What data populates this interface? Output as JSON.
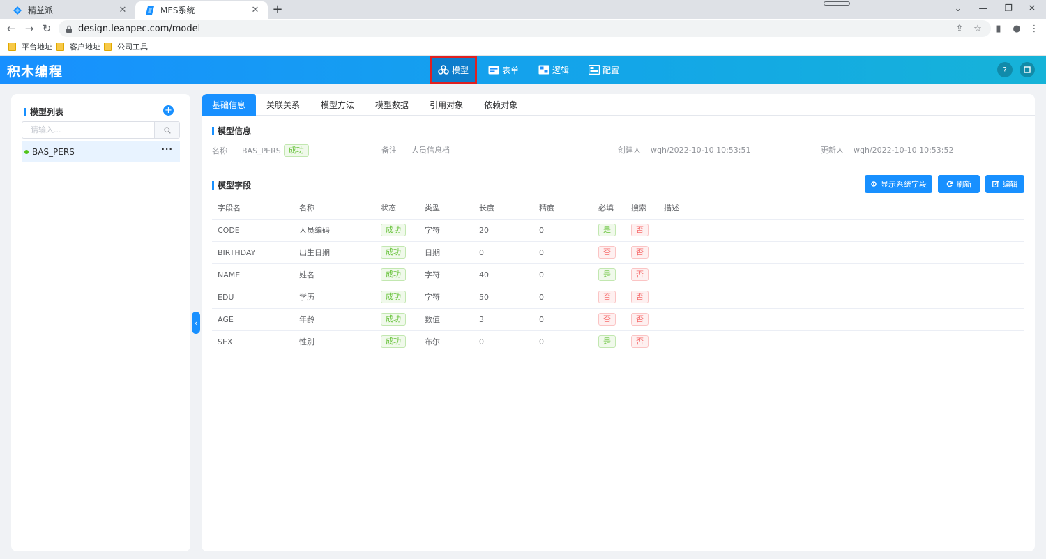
{
  "browser": {
    "tabs": [
      {
        "title": "精益派",
        "active": false
      },
      {
        "title": "MES系统",
        "active": true
      }
    ],
    "url": "design.leanpec.com/model",
    "bookmarks": [
      "平台地址",
      "客户地址",
      "公司工具"
    ]
  },
  "header": {
    "app_title": "积木编程",
    "nav": [
      {
        "label": "模型",
        "icon": "model-icon",
        "active": true
      },
      {
        "label": "表单",
        "icon": "form-icon",
        "active": false
      },
      {
        "label": "逻辑",
        "icon": "logic-icon",
        "active": false
      },
      {
        "label": "配置",
        "icon": "config-icon",
        "active": false
      }
    ]
  },
  "sidebar": {
    "title": "模型列表",
    "search_placeholder": "请输入...",
    "items": [
      {
        "name": "BAS_PERS",
        "more": "···"
      }
    ]
  },
  "main": {
    "tabs": [
      "基础信息",
      "关联关系",
      "模型方法",
      "模型数据",
      "引用对象",
      "依赖对象"
    ],
    "info_title": "模型信息",
    "info": {
      "name_label": "名称",
      "name_value": "BAS_PERS",
      "status": "成功",
      "remark_label": "备注",
      "remark_value": "人员信息档",
      "creator_label": "创建人",
      "creator_value": "wqh/2022-10-10 10:53:51",
      "updater_label": "更新人",
      "updater_value": "wqh/2022-10-10 10:53:52"
    },
    "fields_title": "模型字段",
    "buttons": {
      "show_system": "显示系统字段",
      "refresh": "刷新",
      "edit": "编辑"
    },
    "columns": [
      "字段名",
      "名称",
      "状态",
      "类型",
      "长度",
      "精度",
      "必填",
      "搜索",
      "描述"
    ],
    "rows": [
      {
        "field": "CODE",
        "name": "人员编码",
        "status": "成功",
        "type": "字符",
        "length": "20",
        "precision": "0",
        "required": "是",
        "search": "否",
        "desc": ""
      },
      {
        "field": "BIRTHDAY",
        "name": "出生日期",
        "status": "成功",
        "type": "日期",
        "length": "0",
        "precision": "0",
        "required": "否",
        "search": "否",
        "desc": ""
      },
      {
        "field": "NAME",
        "name": "姓名",
        "status": "成功",
        "type": "字符",
        "length": "40",
        "precision": "0",
        "required": "是",
        "search": "否",
        "desc": ""
      },
      {
        "field": "EDU",
        "name": "学历",
        "status": "成功",
        "type": "字符",
        "length": "50",
        "precision": "0",
        "required": "否",
        "search": "否",
        "desc": ""
      },
      {
        "field": "AGE",
        "name": "年龄",
        "status": "成功",
        "type": "数值",
        "length": "3",
        "precision": "0",
        "required": "否",
        "search": "否",
        "desc": ""
      },
      {
        "field": "SEX",
        "name": "性别",
        "status": "成功",
        "type": "布尔",
        "length": "0",
        "precision": "0",
        "required": "是",
        "search": "否",
        "desc": ""
      }
    ]
  },
  "colors": {
    "primary": "#1890ff",
    "success": "#67c23a",
    "danger": "#f56c6c",
    "highlight_box": "#e02020"
  }
}
